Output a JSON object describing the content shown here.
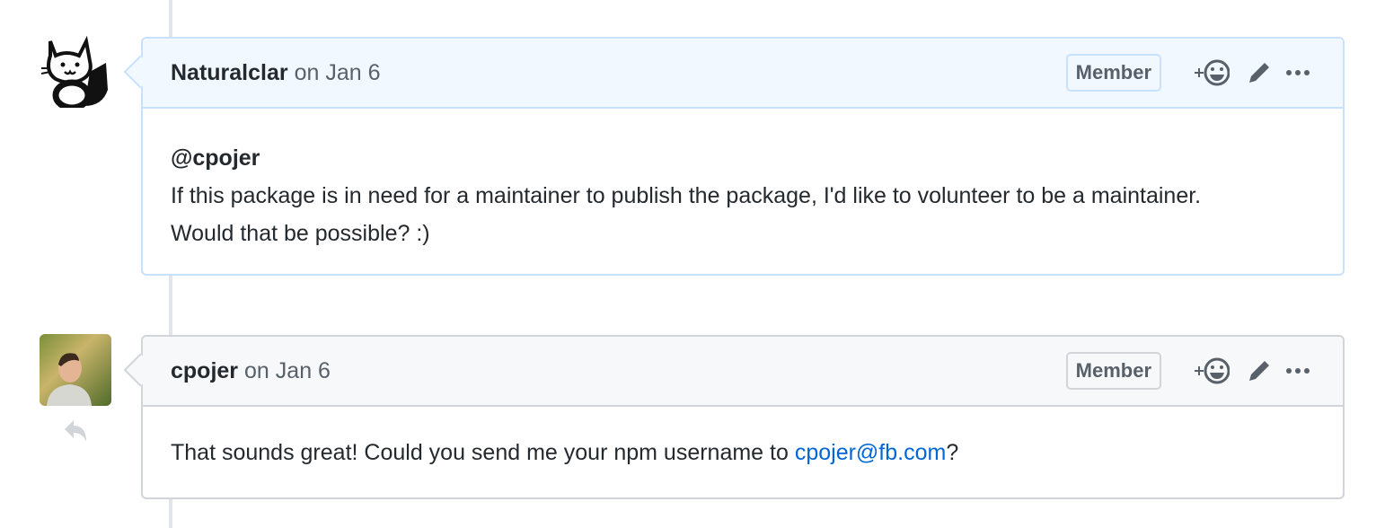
{
  "comments": [
    {
      "author": "Naturalclar",
      "date": "on Jan 6",
      "badge": "Member",
      "mention": "@cpojer",
      "lines": [
        "If this package is in need for a maintainer to publish the package, I'd like to volunteer to be a maintainer.",
        "Would that be possible? :)"
      ]
    },
    {
      "author": "cpojer",
      "date": "on Jan 6",
      "badge": "Member",
      "text_before": "That sounds great! Could you send me your npm username to ",
      "link": "cpojer@fb.com",
      "text_after": "?"
    }
  ],
  "colors": {
    "link": "#0366d6",
    "header_highlight": "#f1f8ff"
  }
}
